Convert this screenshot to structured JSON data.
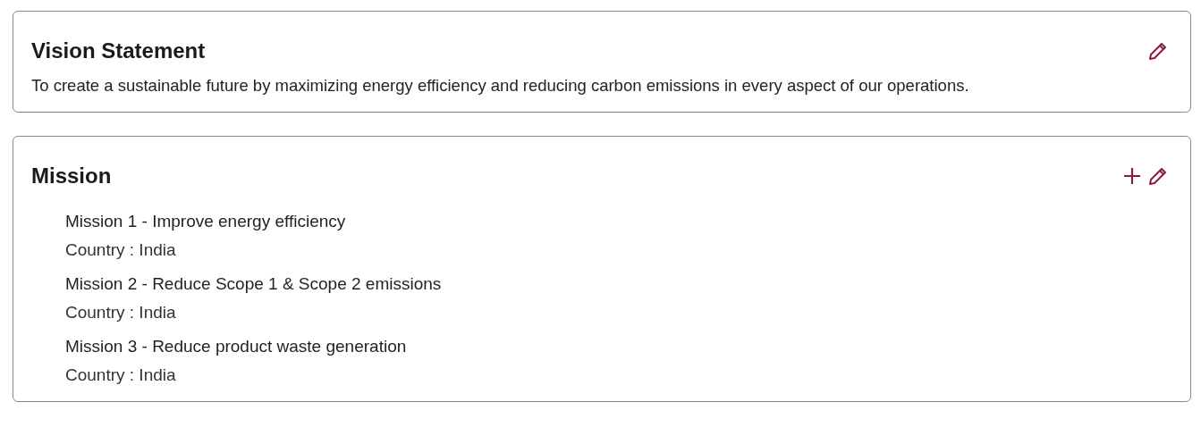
{
  "vision": {
    "title": "Vision Statement",
    "text": "To create a sustainable future by maximizing energy efficiency and reducing carbon emissions in every aspect of our operations."
  },
  "mission": {
    "title": "Mission",
    "items": [
      {
        "title": "Mission 1 - Improve energy efficiency",
        "country": "Country : India"
      },
      {
        "title": "Mission 2 - Reduce Scope 1 & Scope 2 emissions",
        "country": "Country : India"
      },
      {
        "title": "Mission 3 - Reduce product waste generation",
        "country": "Country : India"
      }
    ]
  }
}
